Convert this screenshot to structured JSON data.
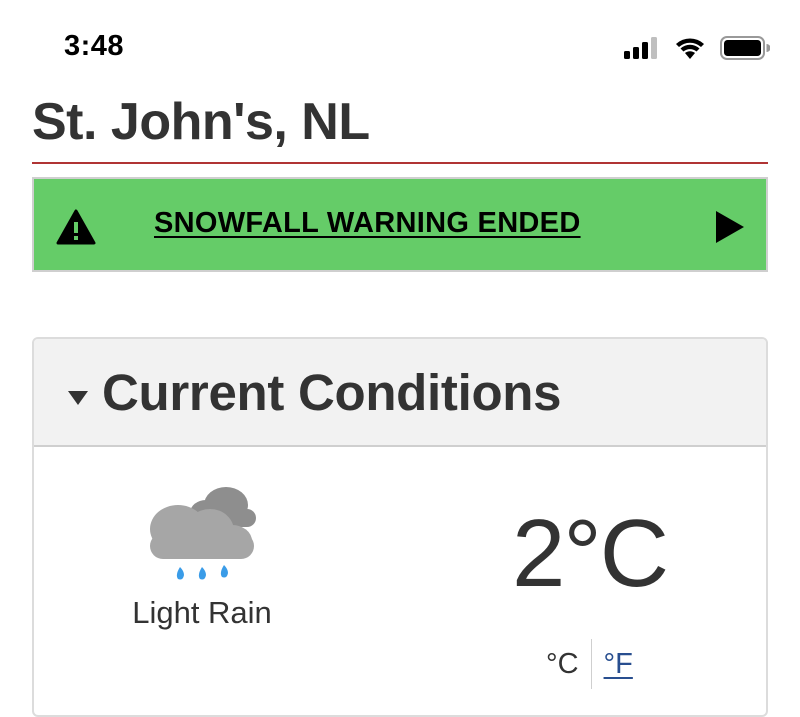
{
  "status_bar": {
    "time": "3:48",
    "icons": [
      "cellular-signal-icon",
      "wifi-icon",
      "battery-icon"
    ]
  },
  "location": {
    "title": "St. John's, NL"
  },
  "alert": {
    "text": "SNOWFALL WARNING ENDED",
    "icon": "warning-triangle-icon",
    "action_icon": "play-arrow-icon",
    "background_color": "#65cc68"
  },
  "current_conditions": {
    "heading": "Current Conditions",
    "expanded": true,
    "condition": "Light Rain",
    "condition_icon": "light-rain-cloud-icon",
    "temperature": "2°C",
    "units": {
      "celsius": "°C",
      "fahrenheit": "°F",
      "selected": "celsius"
    }
  },
  "colors": {
    "title_rule": "#b03434",
    "link": "#284e8f"
  }
}
